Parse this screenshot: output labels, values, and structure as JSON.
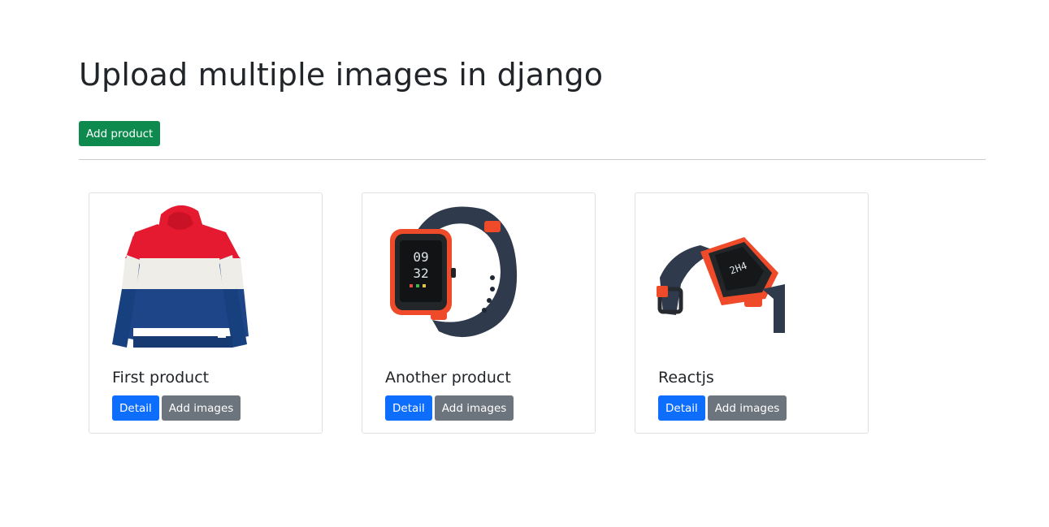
{
  "page": {
    "title": "Upload multiple images in django",
    "add_product_label": "Add product"
  },
  "products": [
    {
      "name": "First product",
      "image": "hoodie-image",
      "detail_label": "Detail",
      "add_images_label": "Add images"
    },
    {
      "name": "Another product",
      "image": "smartwatch-image",
      "detail_label": "Detail",
      "add_images_label": "Add images"
    },
    {
      "name": "Reactjs",
      "image": "smartwatch-side-image",
      "detail_label": "Detail",
      "add_images_label": "Add images"
    }
  ],
  "colors": {
    "success": "#0f8a4f",
    "primary": "#0d6efd",
    "secondary": "#6c757d",
    "text": "#212529"
  }
}
